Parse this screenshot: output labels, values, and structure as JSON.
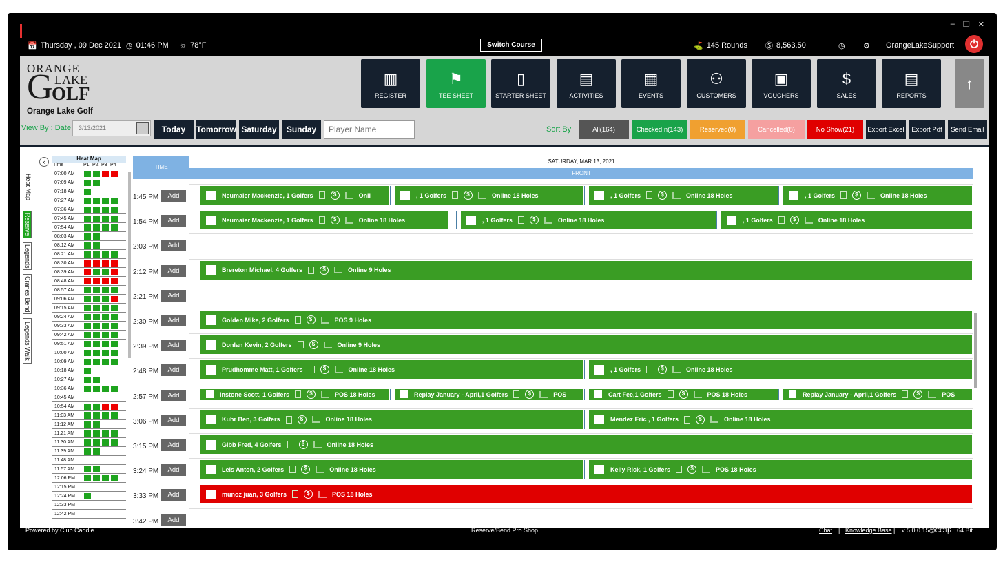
{
  "topbar": {
    "date": "Thursday , 09 Dec 2021",
    "time": "01:46 PM",
    "weather": "78°F",
    "switch_course": "Switch Course",
    "rounds": "145 Rounds",
    "revenue": "8,563.50",
    "user": "OrangeLakeSupport"
  },
  "logo": {
    "line1": "ORANGE",
    "line2": "LAKE",
    "line3": "OLF",
    "big": "G",
    "course_name": "Orange Lake Golf"
  },
  "nav": [
    {
      "label": "REGISTER",
      "icon": "register-icon"
    },
    {
      "label": "TEE SHEET",
      "icon": "tee-sheet-icon",
      "active": true
    },
    {
      "label": "STARTER SHEET",
      "icon": "tablet-icon"
    },
    {
      "label": "ACTIVITIES",
      "icon": "calendar-list-icon"
    },
    {
      "label": "EVENTS",
      "icon": "calendar-edit-icon"
    },
    {
      "label": "CUSTOMERS",
      "icon": "users-icon"
    },
    {
      "label": "VOUCHERS",
      "icon": "voucher-icon"
    },
    {
      "label": "SALES",
      "icon": "sales-icon"
    },
    {
      "label": "REPORTS",
      "icon": "report-icon"
    }
  ],
  "filterbar": {
    "view_by": "View By : Date",
    "date_value": "3/13/2021",
    "days": [
      "Today",
      "Tomorrow",
      "Saturday",
      "Sunday"
    ],
    "player_placeholder": "Player Name",
    "sort_by": "Sort By"
  },
  "filters": [
    {
      "label": "All(164)",
      "color": "#555555"
    },
    {
      "label": "CheckedIn(143)",
      "color": "#19a34a"
    },
    {
      "label": "Reserved(0)",
      "color": "#f0a030"
    },
    {
      "label": "Cancelled(8)",
      "color": "#f5a0a0"
    },
    {
      "label": "No Show(21)",
      "color": "#e00000"
    },
    {
      "label": "Export Excel",
      "color": "#15202e"
    },
    {
      "label": "Export Pdf",
      "color": "#15202e"
    },
    {
      "label": "Send Email",
      "color": "#15202e"
    }
  ],
  "side_tabs": [
    "Heat Map",
    "Reserve",
    "Legends",
    "Cranes Bend",
    "Legends Walk"
  ],
  "heatmap": {
    "title": "Heat Map",
    "cols": [
      "Time",
      "P1",
      "P2",
      "P3",
      "P4"
    ],
    "rows": [
      [
        "07:00 AM",
        "ggrr"
      ],
      [
        "07:09 AM",
        "ggww"
      ],
      [
        "07:18 AM",
        "gwww"
      ],
      [
        "07:27 AM",
        "gggg"
      ],
      [
        "07:36 AM",
        "gggg"
      ],
      [
        "07:45 AM",
        "gggg"
      ],
      [
        "07:54 AM",
        "gggg"
      ],
      [
        "08:03 AM",
        "ggww"
      ],
      [
        "08:12 AM",
        "ggww"
      ],
      [
        "08:21 AM",
        "gggg"
      ],
      [
        "08:30 AM",
        "rrrr"
      ],
      [
        "08:39 AM",
        "rggr"
      ],
      [
        "08:48 AM",
        "rrrr"
      ],
      [
        "08:57 AM",
        "gggg"
      ],
      [
        "09:06 AM",
        "gggr"
      ],
      [
        "09:15 AM",
        "gggg"
      ],
      [
        "09:24 AM",
        "gggg"
      ],
      [
        "09:33 AM",
        "gggg"
      ],
      [
        "09:42 AM",
        "gggg"
      ],
      [
        "09:51 AM",
        "gggg"
      ],
      [
        "10:00 AM",
        "gggg"
      ],
      [
        "10:09 AM",
        "gggg"
      ],
      [
        "10:18 AM",
        "gwww"
      ],
      [
        "10:27 AM",
        "ggww"
      ],
      [
        "10:36 AM",
        "gggg"
      ],
      [
        "10:45 AM",
        "wwww"
      ],
      [
        "10:54 AM",
        "ggrr"
      ],
      [
        "11:03 AM",
        "gggg"
      ],
      [
        "11:12 AM",
        "ggww"
      ],
      [
        "11:21 AM",
        "gggg"
      ],
      [
        "11:30 AM",
        "gggg"
      ],
      [
        "11:39 AM",
        "ggww"
      ],
      [
        "11:48 AM",
        "wwww"
      ],
      [
        "11:57 AM",
        "ggww"
      ],
      [
        "12:06 PM",
        "gggg"
      ],
      [
        "12:15 PM",
        "wwww"
      ],
      [
        "12:24 PM",
        "gwww"
      ],
      [
        "12:33 PM",
        "wwww"
      ],
      [
        "12:42 PM",
        "wwww"
      ]
    ]
  },
  "tee_sheet": {
    "time_header": "TIME",
    "day_title": "SATURDAY, MAR 13, 2021",
    "section": "FRONT",
    "add_label": "Add",
    "times": [
      "1:45 PM",
      "1:54 PM",
      "2:03 PM",
      "2:12 PM",
      "2:21 PM",
      "2:30 PM",
      "2:39 PM",
      "2:48 PM",
      "2:57 PM",
      "3:06 PM",
      "3:15 PM",
      "3:24 PM",
      "3:33 PM",
      "3:42 PM"
    ],
    "bookings": [
      {
        "row": 0,
        "span": [
          0,
          0.245
        ],
        "name": "Neumaier Mackenzie, 1 Golfers",
        "tail": "Onli"
      },
      {
        "row": 0,
        "span": [
          0.25,
          0.495
        ],
        "name": ", 1 Golfers",
        "tail": "Online  18 Holes"
      },
      {
        "row": 0,
        "span": [
          0.5,
          0.745
        ],
        "name": ", 1 Golfers",
        "tail": "Online  18 Holes"
      },
      {
        "row": 0,
        "span": [
          0.75,
          0.995
        ],
        "name": ", 1 Golfers",
        "tail": "Online  18 Holes"
      },
      {
        "row": 1,
        "span": [
          0,
          0.32
        ],
        "name": "Neumaier Mackenzie, 1 Golfers",
        "tail": "Online  18 Holes"
      },
      {
        "row": 1,
        "span": [
          0.335,
          0.665
        ],
        "name": ", 1 Golfers",
        "tail": "Online  18 Holes"
      },
      {
        "row": 1,
        "span": [
          0.67,
          0.995
        ],
        "name": ", 1 Golfers",
        "tail": "Online  18 Holes"
      },
      {
        "row": 3,
        "span": [
          0,
          0.995
        ],
        "name": "Brereton  Michael, 4 Golfers",
        "tail": "Online  9 Holes"
      },
      {
        "row": 5,
        "span": [
          0,
          0.995
        ],
        "name": "Golden Mike, 2 Golfers",
        "tail": "POS  9 Holes"
      },
      {
        "row": 6,
        "span": [
          0,
          0.995
        ],
        "name": "Donlan Kevin, 2 Golfers",
        "tail": "Online  9 Holes"
      },
      {
        "row": 7,
        "span": [
          0,
          0.495
        ],
        "name": "Prudhomme Matt, 1 Golfers",
        "tail": "Online  18 Holes"
      },
      {
        "row": 7,
        "span": [
          0.5,
          0.995
        ],
        "name": ", 1 Golfers",
        "tail": "Online  18 Holes"
      },
      {
        "row": 8,
        "span": [
          0,
          0.245
        ],
        "name": "Instone Scott, 1 Golfers",
        "tail": "POS  18 Holes"
      },
      {
        "row": 8,
        "span": [
          0.25,
          0.495
        ],
        "name": "Replay January - April,1 Golfers",
        "tail": "POS"
      },
      {
        "row": 8,
        "span": [
          0.5,
          0.745
        ],
        "name": "Cart Fee,1 Golfers",
        "tail": "POS  18 Holes"
      },
      {
        "row": 8,
        "span": [
          0.75,
          0.995
        ],
        "name": "Replay January - April,1 Golfers",
        "tail": "POS"
      },
      {
        "row": 9,
        "span": [
          0,
          0.495
        ],
        "name": "Kuhr Ben, 3 Golfers",
        "tail": "Online  18 Holes"
      },
      {
        "row": 9,
        "span": [
          0.5,
          0.995
        ],
        "name": "Mendez Eric , 1 Golfers",
        "tail": "Online  18 Holes"
      },
      {
        "row": 10,
        "span": [
          0,
          0.995
        ],
        "name": "Gibb Fred, 4 Golfers",
        "tail": "Online  18 Holes"
      },
      {
        "row": 11,
        "span": [
          0,
          0.495
        ],
        "name": "Leis Anton, 2 Golfers",
        "tail": "Online  18 Holes"
      },
      {
        "row": 11,
        "span": [
          0.5,
          0.995
        ],
        "name": "Kelly Rick, 1 Golfers",
        "tail": "POS  18 Holes"
      },
      {
        "row": 12,
        "span": [
          0,
          0.995
        ],
        "name": "munoz juan, 3 Golfers",
        "tail": "POS  18 Holes",
        "red": true
      }
    ]
  },
  "footer": {
    "powered": "Powered by Club Caddie",
    "shop": "Reserve/Bend Pro Shop",
    "chat": "Chat",
    "kb": "Knowledge Base",
    "version": "v 5.0.0.15@CC16",
    "bits": "64 Bit"
  }
}
